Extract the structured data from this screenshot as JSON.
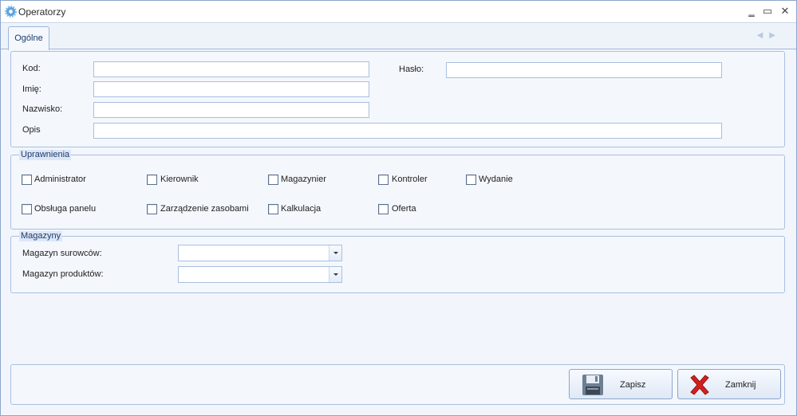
{
  "window": {
    "title": "Operatorzy",
    "minimize": "‗",
    "maximize": "▭",
    "close": "✕"
  },
  "tabs": [
    {
      "label": "Ogólne"
    }
  ],
  "fields": {
    "kod_label": "Kod:",
    "kod_value": "",
    "haslo_label": "Hasło:",
    "haslo_value": "",
    "imie_label": "Imię:",
    "imie_value": "",
    "nazwisko_label": "Nazwisko:",
    "nazwisko_value": "",
    "opis_label": "Opis",
    "opis_value": ""
  },
  "uprawnienia": {
    "caption": "Uprawnienia",
    "items": [
      {
        "label": "Administrator",
        "checked": false
      },
      {
        "label": "Kierownik",
        "checked": false
      },
      {
        "label": "Magazynier",
        "checked": false
      },
      {
        "label": "Kontroler",
        "checked": false
      },
      {
        "label": "Wydanie",
        "checked": false
      },
      {
        "label": "Obsługa panelu",
        "checked": false
      },
      {
        "label": "Zarządzenie zasobami",
        "checked": false
      },
      {
        "label": "Kalkulacja",
        "checked": false
      },
      {
        "label": "Oferta",
        "checked": false
      }
    ]
  },
  "magazyny": {
    "caption": "Magazyny",
    "surowcow_label": "Magazyn surowców:",
    "surowcow_value": "",
    "produktow_label": "Magazyn produktów:",
    "produktow_value": ""
  },
  "buttons": {
    "save_label": "Zapisz",
    "close_label": "Zamknij"
  },
  "icons": {
    "app": "gear-icon",
    "save": "floppy-disk-icon",
    "close": "red-x-icon"
  },
  "colors": {
    "accent": "#1e3a6e",
    "border": "#a9bfdf",
    "close_red": "#d21f1f"
  }
}
